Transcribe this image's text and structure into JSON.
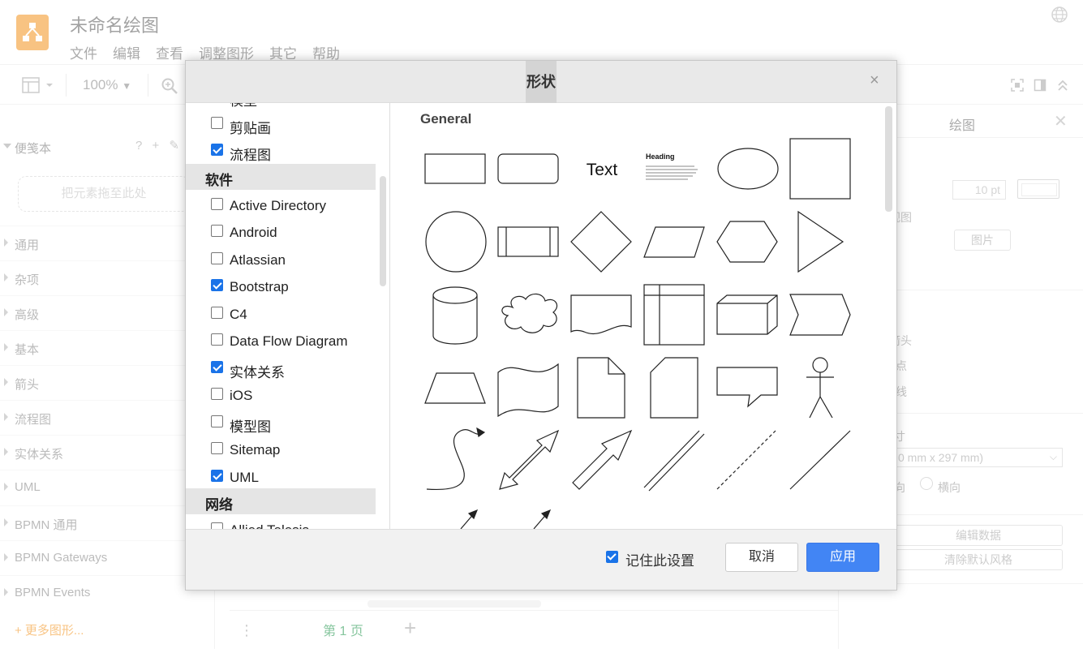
{
  "app": {
    "title": "未命名绘图",
    "menu": [
      "文件",
      "编辑",
      "查看",
      "调整图形",
      "其它",
      "帮助"
    ]
  },
  "toolbar": {
    "zoom": "100%"
  },
  "left_panel": {
    "scratchpad": "便笺本",
    "scratch_icons": "? + ✎ ✕",
    "dropzone": "把元素拖至此处",
    "libraries": [
      "通用",
      "杂项",
      "高级",
      "基本",
      "箭头",
      "流程图",
      "实体关系",
      "UML",
      "BPMN 通用",
      "BPMN Gateways",
      "BPMN Events"
    ],
    "more_shapes": "+ 更多图形..."
  },
  "bottom_bar": {
    "page_tab": "第 1 页",
    "add": "+",
    "menu": "⋮"
  },
  "right_panel": {
    "tab": "绘图",
    "close": "✕",
    "font_size": "10 pt",
    "image_button": "图片",
    "items": [
      "视图",
      "箭头",
      "点",
      "线",
      "寸"
    ],
    "paper_size": "0 mm x 297 mm)",
    "orientation_a": "向",
    "orientation_b": "横向",
    "edit_data": "编辑数据",
    "clear_style": "清除默认风格"
  },
  "dialog": {
    "title": "形状",
    "close": "×",
    "partial_top": "模型",
    "rows_a": [
      {
        "label": "剪贴画",
        "checked": false
      },
      {
        "label": "流程图",
        "checked": true
      }
    ],
    "category_software": "软件",
    "rows_b": [
      {
        "label": "Active Directory",
        "checked": false
      },
      {
        "label": "Android",
        "checked": false
      },
      {
        "label": "Atlassian",
        "checked": false
      },
      {
        "label": "Bootstrap",
        "checked": true
      },
      {
        "label": "C4",
        "checked": false
      },
      {
        "label": "Data Flow Diagram",
        "checked": false
      },
      {
        "label": "实体关系",
        "checked": true
      },
      {
        "label": "iOS",
        "checked": false
      },
      {
        "label": "模型图",
        "checked": false
      },
      {
        "label": "Sitemap",
        "checked": false
      },
      {
        "label": "UML",
        "checked": true
      }
    ],
    "category_network": "网络",
    "partial_bottom": "Allied Telesis",
    "preview_section": "General",
    "text_shape": "Text",
    "heading_shape": "Heading",
    "remember": "记住此设置",
    "cancel": "取消",
    "apply": "应用"
  }
}
